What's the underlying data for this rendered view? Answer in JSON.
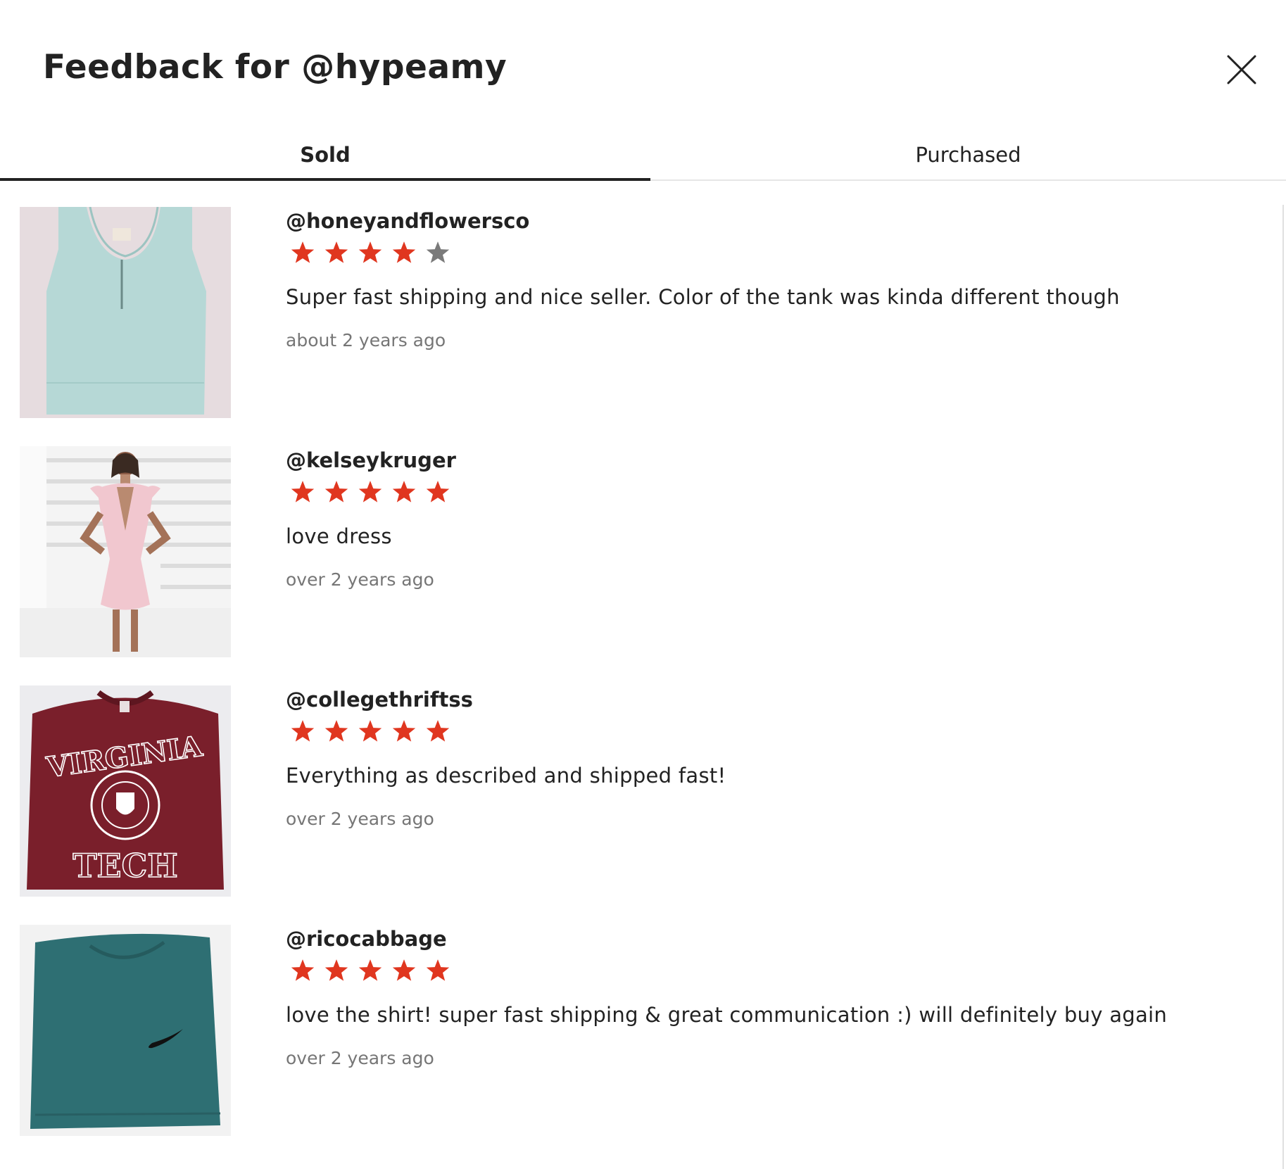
{
  "header": {
    "title": "Feedback for @hypeamy",
    "close_icon": "close-icon"
  },
  "tabs": [
    {
      "label": "Sold",
      "active": true
    },
    {
      "label": "Purchased",
      "active": false
    }
  ],
  "colors": {
    "star_filled": "#e0361f",
    "star_empty": "#7a7a7a",
    "text": "#222222",
    "muted": "#767676"
  },
  "feedback": [
    {
      "username": "@honeyandflowersco",
      "rating": 4,
      "max_rating": 5,
      "comment": "Super fast shipping and nice seller. Color of the tank was kinda different though",
      "time": "about 2 years ago",
      "image": "mint-crop-tank-top"
    },
    {
      "username": "@kelseykruger",
      "rating": 5,
      "max_rating": 5,
      "comment": "love dress",
      "time": "over 2 years ago",
      "image": "pink-ruffle-dress"
    },
    {
      "username": "@collegethriftss",
      "rating": 5,
      "max_rating": 5,
      "comment": "Everything as described and shipped fast!",
      "time": "over 2 years ago",
      "image": "virginia-tech-sweatshirt"
    },
    {
      "username": "@ricocabbage",
      "rating": 5,
      "max_rating": 5,
      "comment": "love the shirt! super fast shipping & great communication :) will definitely buy again",
      "time": "over 2 years ago",
      "image": "teal-nike-tshirt"
    }
  ],
  "thumbnail_text": {
    "sweatshirt_top": "VIRGINIA",
    "sweatshirt_bottom": "TECH"
  }
}
